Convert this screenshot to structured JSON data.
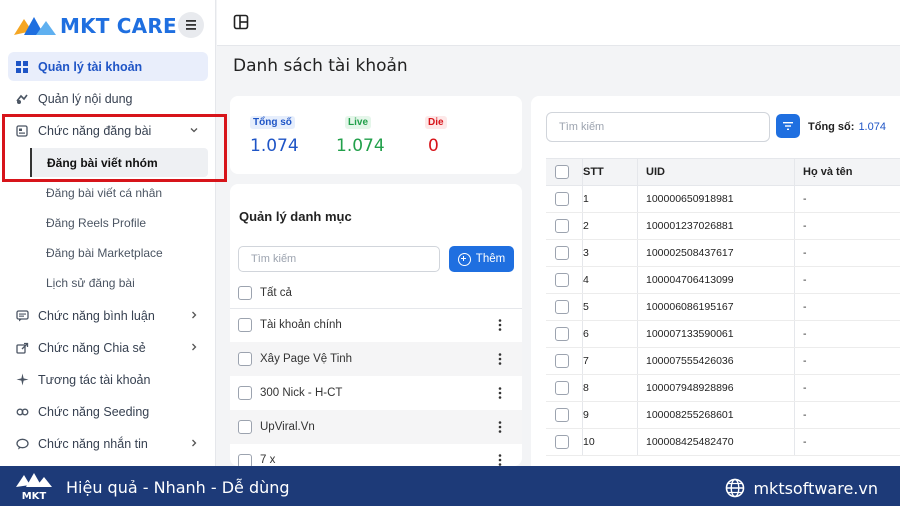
{
  "brand": {
    "name": "MKT CARE"
  },
  "sidebar": {
    "items": [
      {
        "label": "Quản lý tài khoản",
        "icon": "grid-icon"
      },
      {
        "label": "Quản lý nội dung",
        "icon": "content-icon"
      },
      {
        "label": "Chức năng đăng bài",
        "icon": "post-icon"
      },
      {
        "label": "Chức năng bình luận",
        "icon": "comment-icon"
      },
      {
        "label": "Chức năng Chia sẻ",
        "icon": "share-icon"
      },
      {
        "label": "Tương tác tài khoản",
        "icon": "sparkle-icon"
      },
      {
        "label": "Chức năng Seeding",
        "icon": "seeding-icon"
      },
      {
        "label": "Chức năng nhắn tin",
        "icon": "chat-icon"
      }
    ],
    "subitems": [
      "Đăng bài viết nhóm",
      "Đăng bài viết cá nhân",
      "Đăng Reels Profile",
      "Đăng bài Marketplace",
      "Lịch sử đăng bài"
    ]
  },
  "page": {
    "title": "Danh sách tài khoản"
  },
  "stats": {
    "total": {
      "label": "Tổng số",
      "value": "1.074",
      "color": "#1f55c6"
    },
    "live": {
      "label": "Live",
      "value": "1.074",
      "color": "#22a04b"
    },
    "die": {
      "label": "Die",
      "value": "0",
      "color": "#d7141a"
    }
  },
  "categories": {
    "title": "Quản lý danh mục",
    "search_placeholder": "Tìm kiếm",
    "add_label": "Thêm",
    "all_label": "Tất cả",
    "items": [
      "Tài khoản chính",
      "Xây Page Vệ Tinh",
      "300 Nick - H-CT",
      "UpViral.Vn",
      "7 x"
    ]
  },
  "table": {
    "search_placeholder": "Tìm kiếm",
    "total_label": "Tổng số:",
    "total_value": "1.074",
    "columns": [
      "STT",
      "UID",
      "Họ và tên"
    ],
    "rows": [
      [
        "1",
        "100000650918981",
        "-"
      ],
      [
        "2",
        "100001237026881",
        "-"
      ],
      [
        "3",
        "100002508437617",
        "-"
      ],
      [
        "4",
        "100004706413099",
        "-"
      ],
      [
        "5",
        "100006086195167",
        "-"
      ],
      [
        "6",
        "100007133590061",
        "-"
      ],
      [
        "7",
        "100007555426036",
        "-"
      ],
      [
        "8",
        "100007948928896",
        "-"
      ],
      [
        "9",
        "100008255268601",
        "-"
      ],
      [
        "10",
        "100008425482470",
        "-"
      ]
    ]
  },
  "footer": {
    "slogan": "Hiệu quả - Nhanh - Dễ dùng",
    "website": "mktsoftware.vn",
    "logo_text": "MKT"
  }
}
